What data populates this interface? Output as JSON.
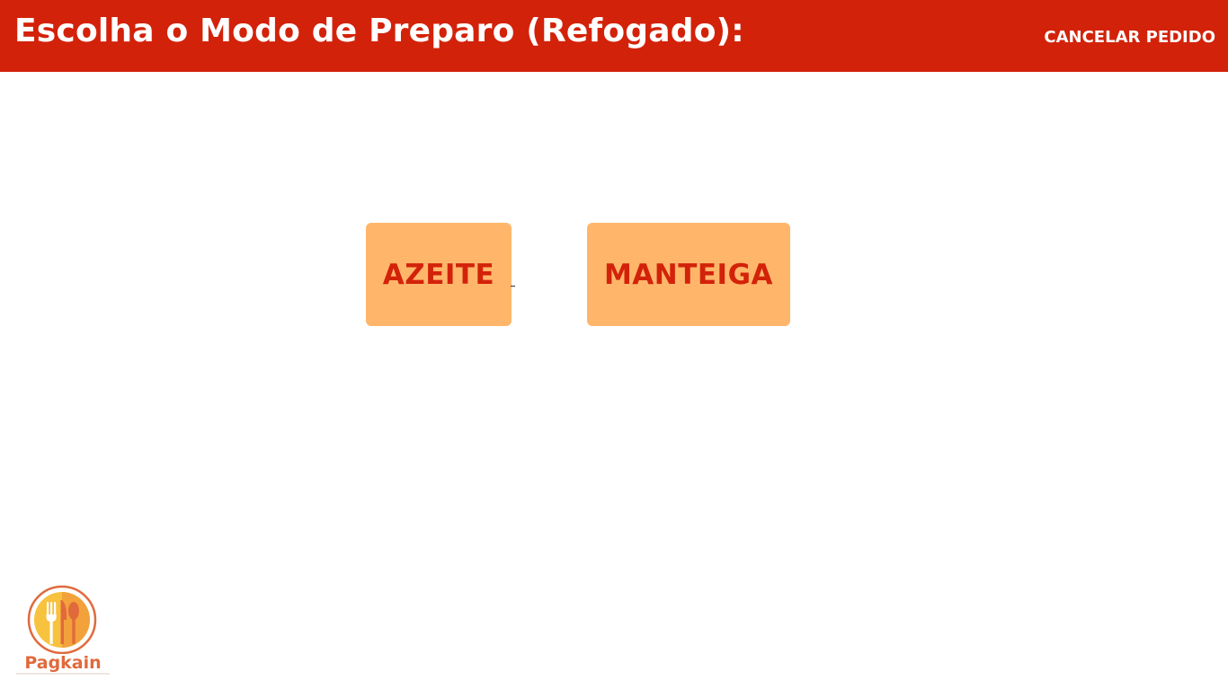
{
  "header": {
    "title": "Escolha o Modo de Preparo (Refogado):",
    "cancel_label": "CANCELAR PEDIDO",
    "background_color": "#d3220a"
  },
  "options": [
    {
      "label": "AZEITE"
    },
    {
      "label": "MANTEIGA"
    }
  ],
  "colors": {
    "option_background": "#ffb66b",
    "option_text": "#d3220a"
  },
  "logo": {
    "brand_name": "Pagkain",
    "icon": "fork-spoon-plate-icon"
  }
}
